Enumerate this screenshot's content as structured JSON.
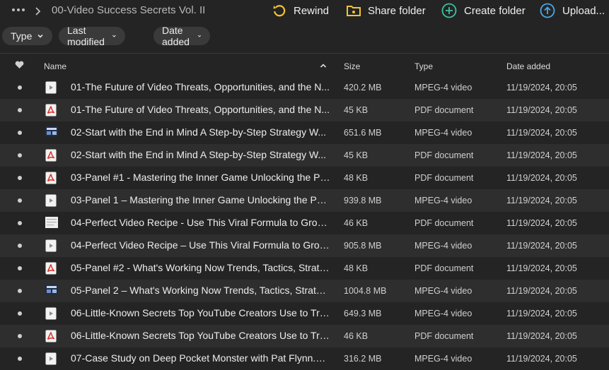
{
  "breadcrumb": {
    "more_icon": "more-horizontal-icon",
    "separator_icon": "chevron-right-icon",
    "current": "00-Video Success Secrets Vol. II"
  },
  "actions": {
    "rewind": {
      "label": "Rewind",
      "icon": "rewind-icon",
      "color": "#f4c430"
    },
    "share_folder": {
      "label": "Share folder",
      "icon": "shared-folder-icon",
      "color": "#f4c430"
    },
    "create_folder": {
      "label": "Create folder",
      "icon": "plus-circle-icon",
      "color": "#3fc1a5"
    },
    "upload": {
      "label": "Upload...",
      "icon": "upload-circle-icon",
      "color": "#4aa8e8"
    }
  },
  "filters": [
    {
      "label": "Type"
    },
    {
      "label": "Last modified"
    },
    {
      "label": "Date added"
    }
  ],
  "table": {
    "columns": {
      "favorite_icon": "heart-icon",
      "name": "Name",
      "sort_icon": "chevron-up-icon",
      "size": "Size",
      "type": "Type",
      "date": "Date added"
    },
    "rows": [
      {
        "name": "01-The Future of Video Threats, Opportunities, and the N...",
        "size": "420.2 MB",
        "type": "MPEG-4 video",
        "date": "11/19/2024, 20:05",
        "icon": "video-file-icon"
      },
      {
        "name": "01-The Future of Video Threats, Opportunities, and the N...",
        "size": "45 KB",
        "type": "PDF document",
        "date": "11/19/2024, 20:05",
        "icon": "pdf-file-icon"
      },
      {
        "name": "02-Start with the End in Mind A Step-by-Step Strategy W...",
        "size": "651.6 MB",
        "type": "MPEG-4 video",
        "date": "11/19/2024, 20:05",
        "icon": "video-thumbnail-icon"
      },
      {
        "name": "02-Start with the End in Mind A Step-by-Step Strategy W...",
        "size": "45 KB",
        "type": "PDF document",
        "date": "11/19/2024, 20:05",
        "icon": "pdf-file-icon"
      },
      {
        "name": "03-Panel #1 - Mastering the Inner Game Unlocking the Po...",
        "size": "48 KB",
        "type": "PDF document",
        "date": "11/19/2024, 20:05",
        "icon": "pdf-file-icon"
      },
      {
        "name": "03-Panel 1 – Mastering the Inner Game Unlocking the Pot...",
        "size": "939.8 MB",
        "type": "MPEG-4 video",
        "date": "11/19/2024, 20:05",
        "icon": "video-file-icon"
      },
      {
        "name": "04-Perfect Video Recipe - Use This Viral Formula to Grow ...",
        "size": "46 KB",
        "type": "PDF document",
        "date": "11/19/2024, 20:05",
        "icon": "document-thumbnail-icon"
      },
      {
        "name": "04-Perfect Video Recipe – Use This Viral Formula to Grow...",
        "size": "905.8 MB",
        "type": "MPEG-4 video",
        "date": "11/19/2024, 20:05",
        "icon": "video-file-icon"
      },
      {
        "name": "05-Panel #2 - What's Working Now Trends, Tactics, Strate...",
        "size": "48 KB",
        "type": "PDF document",
        "date": "11/19/2024, 20:05",
        "icon": "pdf-file-icon"
      },
      {
        "name": "05-Panel 2 – What's Working Now Trends, Tactics, Strateg...",
        "size": "1004.8 MB",
        "type": "MPEG-4 video",
        "date": "11/19/2024, 20:05",
        "icon": "video-thumbnail-icon"
      },
      {
        "name": "06-Little-Known Secrets Top YouTube Creators Use to Trig...",
        "size": "649.3 MB",
        "type": "MPEG-4 video",
        "date": "11/19/2024, 20:05",
        "icon": "video-file-icon"
      },
      {
        "name": "06-Little-Known Secrets Top YouTube Creators Use to Trig...",
        "size": "46 KB",
        "type": "PDF document",
        "date": "11/19/2024, 20:05",
        "icon": "pdf-file-icon"
      },
      {
        "name": "07-Case Study on Deep Pocket Monster with Pat Flynn.m...",
        "size": "316.2 MB",
        "type": "MPEG-4 video",
        "date": "11/19/2024, 20:05",
        "icon": "video-file-icon"
      }
    ]
  }
}
